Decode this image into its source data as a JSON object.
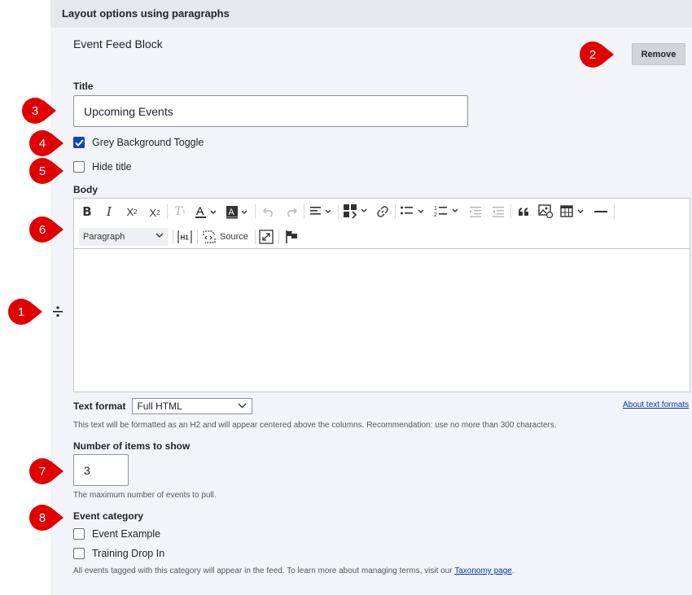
{
  "section": {
    "title": "Layout options using paragraphs"
  },
  "block": {
    "label": "Event Feed Block",
    "remove_label": "Remove"
  },
  "title_field": {
    "label": "Title",
    "value": "Upcoming Events"
  },
  "checkboxes": {
    "grey_background": {
      "label": "Grey Background Toggle",
      "checked": true
    },
    "hide_title": {
      "label": "Hide title",
      "checked": false
    }
  },
  "body": {
    "label": "Body",
    "paragraph_style": "Paragraph",
    "source_label": "Source"
  },
  "text_format": {
    "label": "Text format",
    "selected": "Full HTML",
    "about_link": "About text formats",
    "help": "This text will be formatted as an H2 and will appear centered above the columns. Recommendation: use no more than 300 characters."
  },
  "items_field": {
    "label": "Number of items to show",
    "value": "3",
    "help": "The maximum number of events to pull."
  },
  "event_category": {
    "label": "Event category",
    "options": [
      {
        "label": "Event Example",
        "checked": false
      },
      {
        "label": "Training Drop In",
        "checked": false
      }
    ],
    "help_prefix": "All events tagged with this category will appear in the feed. To learn more about managing terms, visit our ",
    "help_link": "Taxonomy page",
    "help_suffix": "."
  },
  "markers": [
    "1",
    "2",
    "3",
    "4",
    "5",
    "6",
    "7",
    "8"
  ],
  "colors": {
    "marker": "#e00000",
    "checkbox_checked": "#0d47b7",
    "link": "#0036b1",
    "panel": "#f3f4f9"
  }
}
